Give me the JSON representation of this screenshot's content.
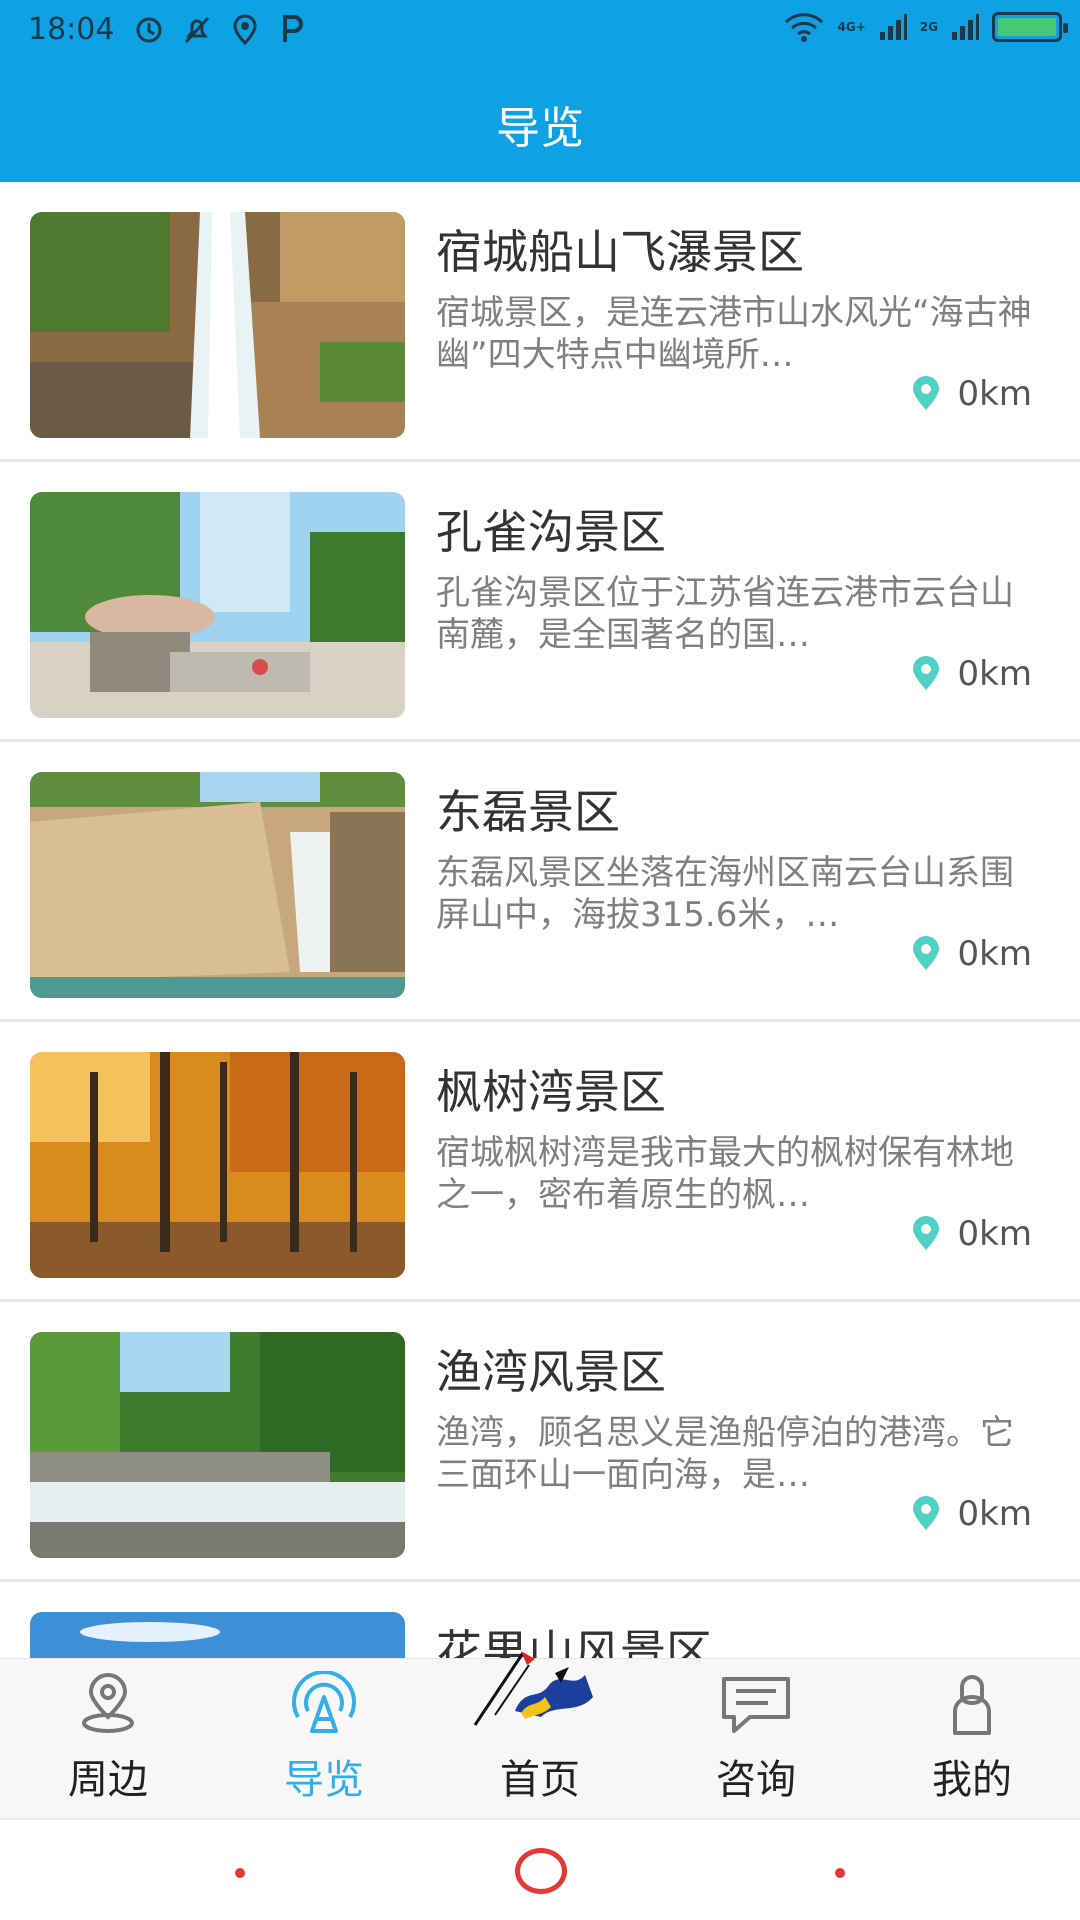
{
  "status": {
    "time": "18:04",
    "net1": "4G+",
    "net2": "2G"
  },
  "header": {
    "title": "导览"
  },
  "items": [
    {
      "name": "宿城船山飞瀑景区",
      "desc": "宿城景区，是连云港市山水风光“海古神幽”四大特点中幽境所…",
      "distance": "0km"
    },
    {
      "name": "孔雀沟景区",
      "desc": "孔雀沟景区位于江苏省连云港市云台山南麓，是全国著名的国…",
      "distance": "0km"
    },
    {
      "name": "东磊景区",
      "desc": "东磊风景区坐落在海州区南云台山系围屏山中，海拔315.6米，…",
      "distance": "0km"
    },
    {
      "name": "枫树湾景区",
      "desc": "宿城枫树湾是我市最大的枫树保有林地之一，密布着原生的枫…",
      "distance": "0km"
    },
    {
      "name": "渔湾风景区",
      "desc": "渔湾，顾名思义是渔船停泊的港湾。它三面环山一面向海，是…",
      "distance": "0km"
    },
    {
      "name": "花果山风景区",
      "desc": "",
      "distance": ""
    }
  ],
  "nav": {
    "tabs": [
      {
        "label": "周边",
        "icon": "location-pin-icon"
      },
      {
        "label": "导览",
        "icon": "broadcast-icon",
        "active": true
      },
      {
        "label": "首页",
        "icon": "logo-icon"
      },
      {
        "label": "咨询",
        "icon": "chat-icon"
      },
      {
        "label": "我的",
        "icon": "user-icon"
      }
    ]
  },
  "colors": {
    "header": "#0ea2e4",
    "accent": "#33aee8",
    "pin": "#4fd1c5"
  }
}
